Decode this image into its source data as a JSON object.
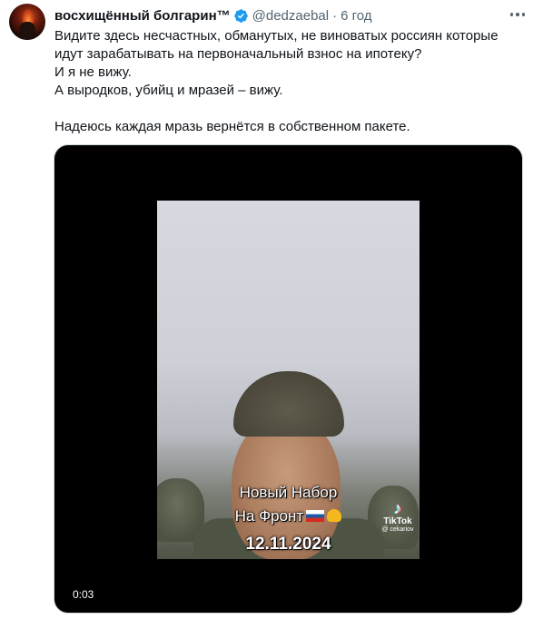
{
  "author": {
    "name": "восхищённый болгарин™",
    "handle": "@dedzaebal",
    "separator": "·",
    "time": "6 год",
    "avatar_icon": "avatar-image",
    "verified_icon": "verified-badge-icon",
    "verified_color": "#1d9bf0"
  },
  "tweet": {
    "lines": [
      "Видите здесь несчастных, обманутых, не виноватых россиян которые",
      "идут зарабатывать на первоначальный взнос на ипотеку?",
      "И я не вижу.",
      "А выродков, убийц и мразей – вижу.",
      "",
      "Надеюсь каждая мразь вернётся в собственном пакете."
    ]
  },
  "video": {
    "caption_line1": "Новый Набор",
    "caption_line2": "На Фронт",
    "caption_date": "12.11.2024",
    "watermark_brand": "TikTok",
    "watermark_user": "@ cekariov",
    "elapsed": "0:03"
  },
  "colors": {
    "text": "#0f1419",
    "secondary": "#536471",
    "media_bg": "#000000"
  }
}
